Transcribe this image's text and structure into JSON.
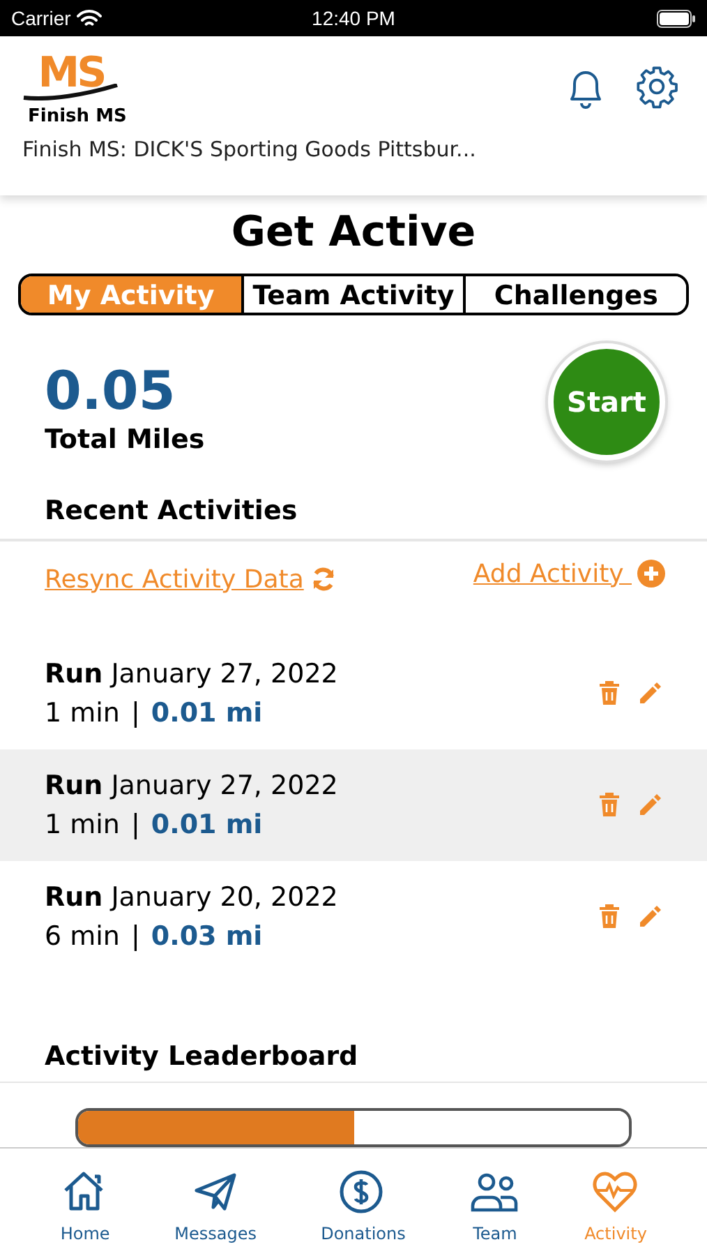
{
  "status_bar": {
    "carrier": "Carrier",
    "time": "12:40 PM"
  },
  "header": {
    "logo_text": "MS",
    "logo_caption": "Finish MS",
    "event_name": "Finish MS: DICK'S Sporting Goods Pittsbur..."
  },
  "title": "Get Active",
  "tabs": [
    {
      "label": "My Activity",
      "selected": true
    },
    {
      "label": "Team Activity",
      "selected": false
    },
    {
      "label": "Challenges",
      "selected": false
    }
  ],
  "summary": {
    "value": "0.05",
    "label": "Total Miles",
    "start_button": "Start"
  },
  "recent": {
    "heading": "Recent Activities",
    "resync_link": "Resync Activity Data",
    "add_link": "Add Activity "
  },
  "activities": [
    {
      "type": "Run",
      "date": "January 27, 2022",
      "duration": "1 min",
      "separator": "|",
      "distance": "0.01 mi"
    },
    {
      "type": "Run",
      "date": "January 27, 2022",
      "duration": "1 min",
      "separator": "|",
      "distance": "0.01 mi"
    },
    {
      "type": "Run",
      "date": "January 20, 2022",
      "duration": "6 min",
      "separator": "|",
      "distance": "0.03 mi"
    }
  ],
  "leaderboard": {
    "heading": "Activity Leaderboard",
    "tabs": [
      {
        "selected": true
      },
      {
        "selected": false
      }
    ]
  },
  "tab_bar": [
    {
      "label": "Home",
      "kind": "home",
      "selected": false
    },
    {
      "label": "Messages",
      "kind": "messages",
      "selected": false
    },
    {
      "label": "Donations",
      "kind": "donations",
      "selected": false
    },
    {
      "label": "Team",
      "kind": "team",
      "selected": false
    },
    {
      "label": "Activity",
      "kind": "activity",
      "selected": true
    }
  ]
}
